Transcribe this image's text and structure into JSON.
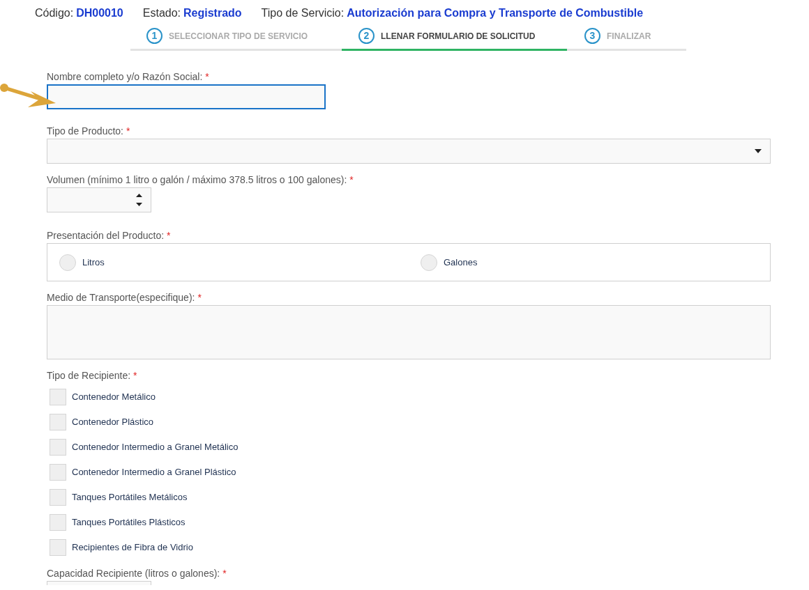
{
  "header": [
    {
      "label": "Código:",
      "value": "DH00010"
    },
    {
      "label": "Estado:",
      "value": "Registrado"
    },
    {
      "label": "Tipo de Servicio:",
      "value": "Autorización para Compra y Transporte de Combustible"
    }
  ],
  "steps": [
    {
      "number": "1",
      "label": "SELECCIONAR TIPO DE SERVICIO",
      "selected": false
    },
    {
      "number": "2",
      "label": "LLENAR FORMULARIO DE SOLICITUD",
      "selected": true
    },
    {
      "number": "3",
      "label": "FINALIZAR",
      "selected": false
    }
  ],
  "fields": [
    {
      "kind": "text",
      "label": "Nombre completo y/o Razón Social:",
      "required_mark": "*",
      "focused": true
    },
    {
      "kind": "select",
      "label": "Tipo de Producto:",
      "required_mark": "*"
    },
    {
      "kind": "number",
      "label": "Volumen (mínimo 1 litro o galón / máximo 378.5 litros o 100 galones):",
      "required_mark": "*"
    },
    {
      "kind": "radio",
      "label": "Presentación del Producto:",
      "required_mark": "*",
      "options": [
        {
          "label": "Litros",
          "selected": false
        },
        {
          "label": "Galones",
          "selected": false
        }
      ]
    },
    {
      "kind": "textarea",
      "label": "Medio de Transporte(especifique):",
      "required_mark": "*"
    },
    {
      "kind": "checkboxes",
      "label": "Tipo de Recipiente:",
      "required_mark": "*",
      "options": [
        {
          "label": "Contenedor Metálico",
          "checked": false
        },
        {
          "label": "Contenedor Plástico",
          "checked": false
        },
        {
          "label": "Contenedor Intermedio a Granel Metálico",
          "checked": false
        },
        {
          "label": "Contenedor Intermedio a Granel Plástico",
          "checked": false
        },
        {
          "label": "Tanques Portátiles Metálicos",
          "checked": false
        },
        {
          "label": "Tanques Portátiles Plásticos",
          "checked": false
        },
        {
          "label": "Recipientes de Fibra de Vidrio",
          "checked": false
        }
      ]
    },
    {
      "kind": "cut",
      "label": "Capacidad Recipiente (litros o galones):",
      "required_mark": "*"
    }
  ]
}
